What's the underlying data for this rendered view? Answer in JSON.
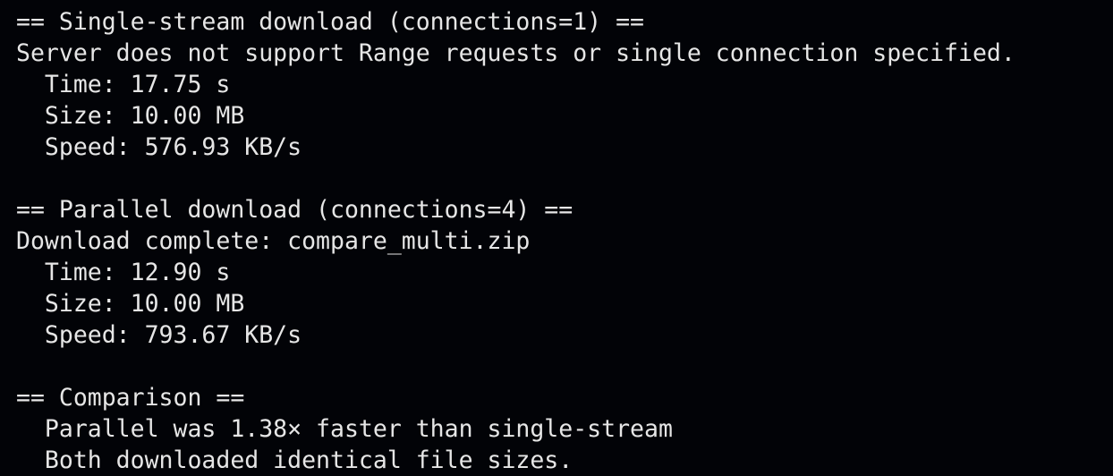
{
  "terminal": {
    "lines": [
      "== Single-stream download (connections=1) ==",
      "Server does not support Range requests or single connection specified.",
      "  Time: 17.75 s",
      "  Size: 10.00 MB",
      "  Speed: 576.93 KB/s",
      "",
      "== Parallel download (connections=4) ==",
      "Download complete: compare_multi.zip",
      "  Time: 12.90 s",
      "  Size: 10.00 MB",
      "  Speed: 793.67 KB/s",
      "",
      "== Comparison ==",
      "  Parallel was 1.38× faster than single-stream",
      "  Both downloaded identical file sizes."
    ]
  }
}
